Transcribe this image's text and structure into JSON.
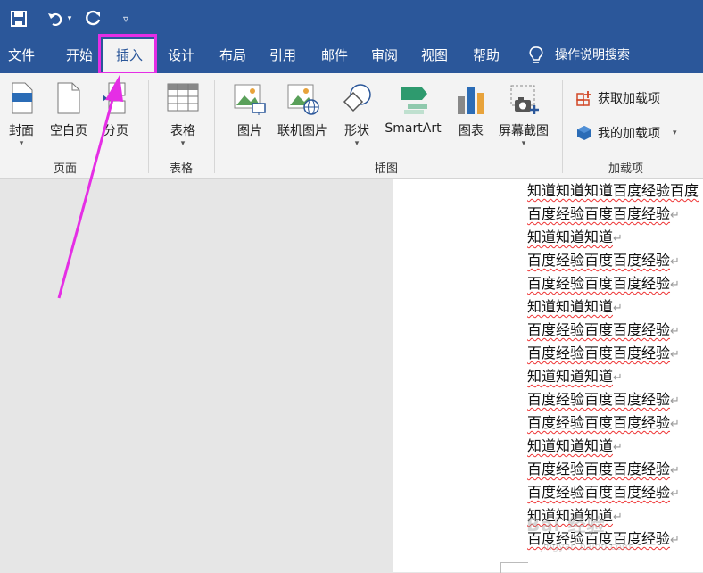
{
  "qat": {
    "save_icon": "save-icon",
    "undo_icon": "undo-icon",
    "redo_icon": "redo-icon",
    "customize_icon": "customize-qat-icon"
  },
  "tabs": [
    {
      "label": "文件"
    },
    {
      "label": "开始"
    },
    {
      "label": "插入"
    },
    {
      "label": "设计"
    },
    {
      "label": "布局"
    },
    {
      "label": "引用"
    },
    {
      "label": "邮件"
    },
    {
      "label": "审阅"
    },
    {
      "label": "视图"
    },
    {
      "label": "帮助"
    }
  ],
  "search": {
    "label": "操作说明搜索"
  },
  "ribbon": {
    "pages": {
      "group_label": "页面",
      "cover": "封面",
      "blank": "空白页",
      "break": "分页"
    },
    "table": {
      "group_label": "表格",
      "table": "表格"
    },
    "illustrations": {
      "group_label": "插图",
      "picture": "图片",
      "online_picture": "联机图片",
      "shapes": "形状",
      "smartart": "SmartArt",
      "chart": "图表",
      "screenshot": "屏幕截图"
    },
    "addins": {
      "group_label": "加载项",
      "get": "获取加载项",
      "my": "我的加载项"
    }
  },
  "document": {
    "lines": [
      "知道知道知道百度经验百度",
      "百度经验百度百度经验",
      "知道知道知道",
      "百度经验百度百度经验",
      "百度经验百度百度经验",
      "知道知道知道",
      "百度经验百度百度经验",
      "百度经验百度百度经验",
      "知道知道知道",
      "百度经验百度百度经验",
      "百度经验百度百度经验",
      "知道知道知道",
      "百度经验百度百度经验",
      "百度经验百度百度经验",
      "知道知道知道",
      "百度经验百度百度经验"
    ],
    "para_mark": "↵"
  },
  "watermark": {
    "text": "Bai 经验",
    "sub": "jingyan.baidu.com"
  }
}
